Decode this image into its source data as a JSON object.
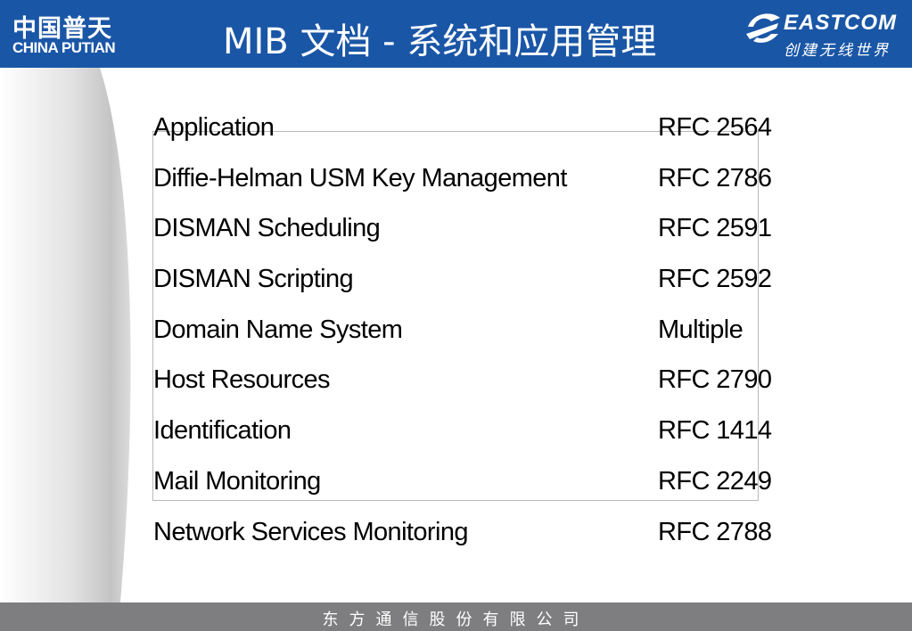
{
  "header": {
    "logo_left_cn": "中国普天",
    "logo_left_en": "CHINA PUTIAN",
    "title": "MIB 文档 - 系统和应用管理",
    "logo_right_brand": "EASTCOM",
    "logo_right_slogan": "创建无线世界"
  },
  "table": {
    "rows": [
      {
        "name": "Application",
        "rfc": "RFC 2564"
      },
      {
        "name": "Diffie-Helman USM Key Management",
        "rfc": "RFC 2786"
      },
      {
        "name": "DISMAN Scheduling",
        "rfc": "RFC 2591"
      },
      {
        "name": "DISMAN Scripting",
        "rfc": "RFC 2592"
      },
      {
        "name": "Domain Name System",
        "rfc": "Multiple"
      },
      {
        "name": "Host Resources",
        "rfc": "RFC 2790"
      },
      {
        "name": "Identification",
        "rfc": "RFC 1414"
      },
      {
        "name": "Mail Monitoring",
        "rfc": "RFC 2249"
      },
      {
        "name": "Network Services Monitoring",
        "rfc": "RFC 2788"
      }
    ]
  },
  "footer": {
    "company": "东方通信股份有限公司"
  },
  "colors": {
    "header_blue": "#1a56a6",
    "footer_gray": "#7e7e80",
    "text": "#000000"
  }
}
